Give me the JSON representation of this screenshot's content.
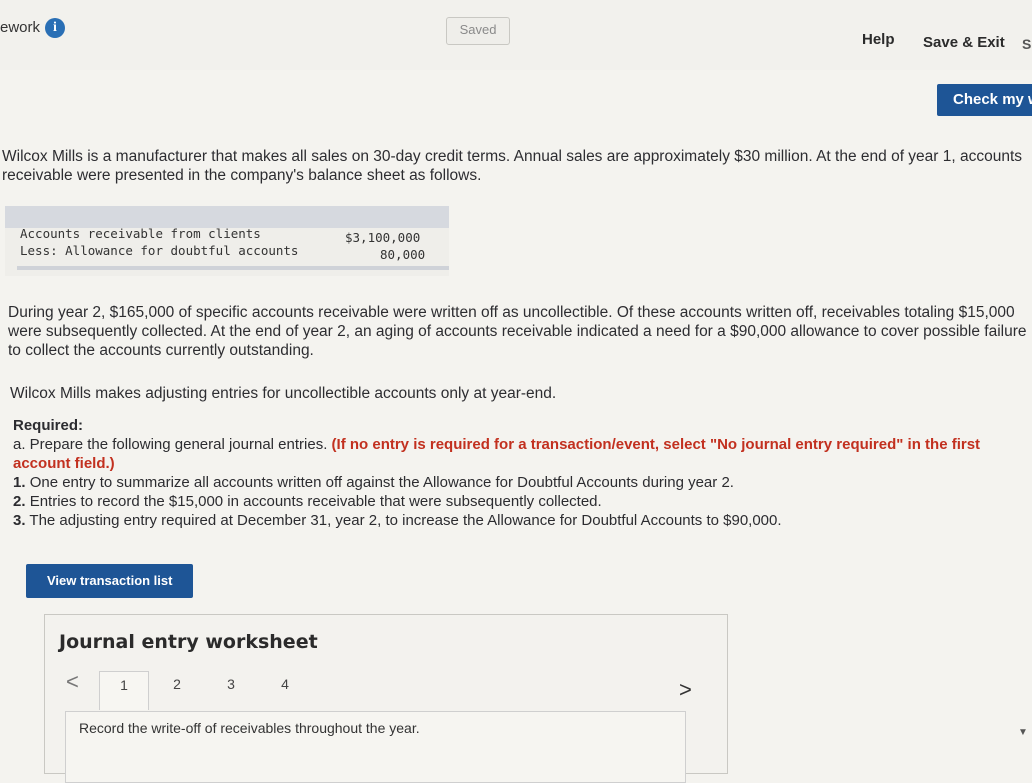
{
  "header": {
    "homework_label": "ework",
    "info_icon": "i",
    "saved_label": "Saved",
    "help_label": "Help",
    "save_exit_label": "Save & Exit",
    "cut_label": "S",
    "check_label": "Check my w"
  },
  "problem": {
    "intro": "Wilcox Mills is a manufacturer that makes all sales on 30-day credit terms. Annual sales are approximately $30 million. At the end of year 1, accounts receivable were presented in the company's balance sheet as follows.",
    "balance_sheet": [
      {
        "label": "Accounts receivable from clients",
        "amount": "$3,100,000"
      },
      {
        "label": "Less: Allowance for doubtful accounts",
        "amount": "80,000"
      }
    ],
    "para2": "During year 2, $165,000 of specific accounts receivable were written off as uncollectible. Of these accounts written off, receivables totaling $15,000 were subsequently collected. At the end of year 2, an aging of accounts receivable indicated a need for a $90,000 allowance to cover possible failure to collect the accounts currently outstanding.",
    "para3": "Wilcox Mills makes adjusting entries for uncollectible accounts only at year-end."
  },
  "required": {
    "title": "Required:",
    "a_text": "a. Prepare the following general journal entries.",
    "a_note": "(If no entry is required for a transaction/event, select \"No journal entry required\" in the first account field.)",
    "items": [
      {
        "num": "1.",
        "text": "One entry to summarize all accounts written off against the Allowance for Doubtful Accounts during year 2."
      },
      {
        "num": "2.",
        "text": "Entries to record the $15,000 in accounts receivable that were subsequently collected."
      },
      {
        "num": "3.",
        "text": "The adjusting entry required at December 31, year 2, to increase the Allowance for Doubtful Accounts to $90,000."
      }
    ]
  },
  "view_transaction_label": "View transaction list",
  "worksheet": {
    "title": "Journal entry worksheet",
    "prev": "<",
    "next": ">",
    "tabs": [
      "1",
      "2",
      "3",
      "4"
    ],
    "active_tab": "1",
    "instruction": "Record the write-off of receivables throughout the year."
  }
}
